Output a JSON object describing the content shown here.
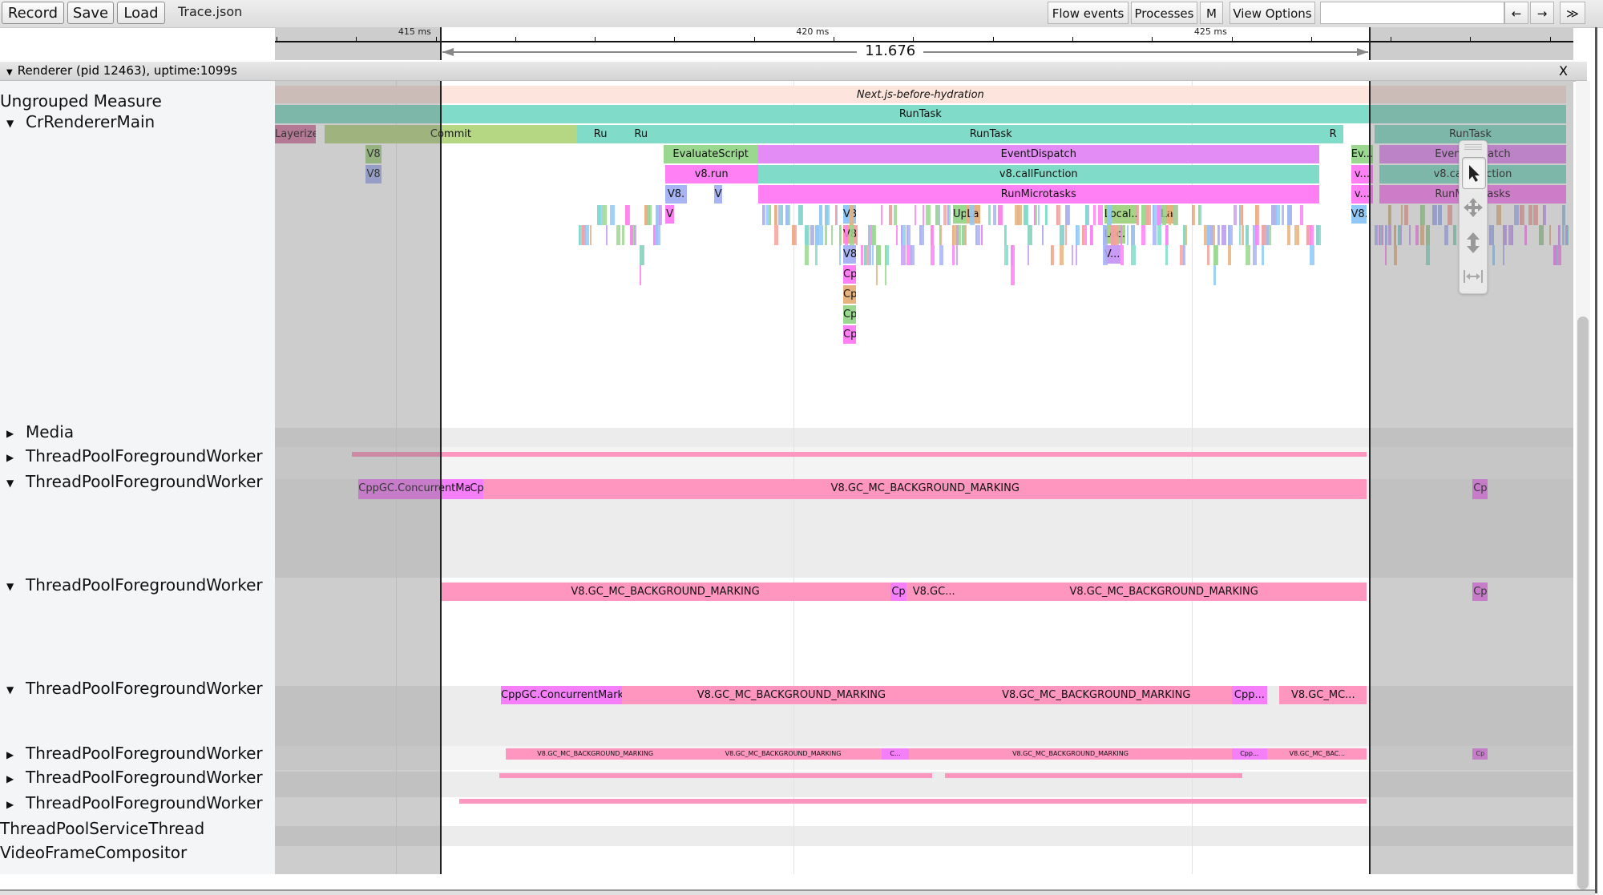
{
  "toolbar": {
    "record_label": "Record",
    "save_label": "Save",
    "load_label": "Load",
    "file_name": "Trace.json",
    "flow_events_label": "Flow events",
    "processes_label": "Processes",
    "m_label": "M",
    "view_options_label": "View Options",
    "search_value": "",
    "prev_label": "←",
    "next_label": "→",
    "expand_label": "≫"
  },
  "ruler": {
    "ticks": [
      {
        "ms": 415,
        "label": "415 ms"
      },
      {
        "ms": 420,
        "label": "420 ms"
      },
      {
        "ms": 425,
        "label": "425 ms"
      }
    ],
    "selection_start_ms": 415.56,
    "selection_end_ms": 427.236,
    "selection_duration_label": "11.676 ms"
  },
  "process": {
    "title": "Renderer (pid 12463), uptime:1099s",
    "close_label": "X"
  },
  "threads": [
    {
      "name": "Ungrouped Measure",
      "arrow": ""
    },
    {
      "name": "CrRendererMain",
      "arrow": "▼"
    },
    {
      "name": "Media",
      "arrow": "▶"
    },
    {
      "name": "ThreadPoolForegroundWorker",
      "arrow": "▶"
    },
    {
      "name": "ThreadPoolForegroundWorker",
      "arrow": "▼"
    },
    {
      "name": "ThreadPoolForegroundWorker",
      "arrow": "▼"
    },
    {
      "name": "ThreadPoolForegroundWorker",
      "arrow": "▼"
    },
    {
      "name": "ThreadPoolForegroundWorker",
      "arrow": "▶"
    },
    {
      "name": "ThreadPoolForegroundWorker",
      "arrow": "▶"
    },
    {
      "name": "ThreadPoolForegroundWorker",
      "arrow": "▶"
    },
    {
      "name": "ThreadPoolServiceThread",
      "arrow": ""
    },
    {
      "name": "VideoFrameCompositor",
      "arrow": ""
    }
  ],
  "colors": {
    "measure": "#fde5dd",
    "runtask": "#80dcc8",
    "commit": "#b5d683",
    "layerize": "#d87aa6",
    "eventdispatch": "#e48cf5",
    "callfunction": "#80dcc8",
    "microtasks": "#ff80f5",
    "gcmarking": "#ff96c0",
    "cppgc": "#f47ff8",
    "v8blue": "#90c8f8",
    "v8red": "#f7a19a",
    "v8violet": "#a8b4f4",
    "green": "#9ad88f",
    "orange": "#e6b27f",
    "purple": "#c89cf4",
    "lightgreen": "#a6d487"
  },
  "slices": [
    {
      "track": "measure",
      "depth": 0,
      "start": 413.48,
      "end": 429.7,
      "name": "Next.js-before-hydration",
      "color": "measure",
      "italic": true
    },
    {
      "track": "main",
      "depth": 0,
      "start": 413.48,
      "end": 429.7,
      "name": "RunTask",
      "color": "runtask"
    },
    {
      "track": "main",
      "depth": 1,
      "start": 413.48,
      "end": 413.99,
      "name": "Layerize",
      "color": "layerize"
    },
    {
      "track": "main",
      "depth": 1,
      "start": 414.1,
      "end": 417.28,
      "name": "Commit",
      "color": "commit"
    },
    {
      "track": "main",
      "depth": 1,
      "start": 417.28,
      "end": 417.86,
      "name": "Ru",
      "color": "runtask"
    },
    {
      "track": "main",
      "depth": 1,
      "start": 417.86,
      "end": 418.3,
      "name": "Ru",
      "color": "runtask"
    },
    {
      "track": "main",
      "depth": 1,
      "start": 418.3,
      "end": 426.65,
      "name": "RunTask",
      "color": "runtask"
    },
    {
      "track": "main",
      "depth": 1,
      "start": 426.65,
      "end": 426.9,
      "name": "R",
      "color": "runtask"
    },
    {
      "track": "main",
      "depth": 1,
      "start": 427.3,
      "end": 429.7,
      "name": "RunTask",
      "color": "runtask"
    },
    {
      "track": "main",
      "depth": 2,
      "start": 414.62,
      "end": 414.82,
      "name": "V8",
      "color": "lightgreen"
    },
    {
      "track": "main",
      "depth": 2,
      "start": 418.36,
      "end": 419.55,
      "name": "EvaluateScript",
      "color": "green"
    },
    {
      "track": "main",
      "depth": 2,
      "start": 419.55,
      "end": 426.6,
      "name": "EventDispatch",
      "color": "eventdispatch"
    },
    {
      "track": "main",
      "depth": 2,
      "start": 427.0,
      "end": 427.28,
      "name": "Ev...",
      "color": "green"
    },
    {
      "track": "main",
      "depth": 2,
      "start": 427.36,
      "end": 429.7,
      "name": "EventDispatch",
      "color": "eventdispatch"
    },
    {
      "track": "main",
      "depth": 3,
      "start": 414.62,
      "end": 414.82,
      "name": "V8",
      "color": "v8violet"
    },
    {
      "track": "main",
      "depth": 3,
      "start": 418.38,
      "end": 419.55,
      "name": "v8.run",
      "color": "microtasks"
    },
    {
      "track": "main",
      "depth": 3,
      "start": 419.55,
      "end": 426.6,
      "name": "v8.callFunction",
      "color": "callfunction"
    },
    {
      "track": "main",
      "depth": 3,
      "start": 427.0,
      "end": 427.28,
      "name": "v...",
      "color": "microtasks"
    },
    {
      "track": "main",
      "depth": 3,
      "start": 427.36,
      "end": 429.7,
      "name": "v8.callFunction",
      "color": "callfunction"
    },
    {
      "track": "main",
      "depth": 4,
      "start": 418.38,
      "end": 418.66,
      "name": "V8.",
      "color": "v8violet"
    },
    {
      "track": "main",
      "depth": 4,
      "start": 419.0,
      "end": 419.1,
      "name": "V",
      "color": "v8violet"
    },
    {
      "track": "main",
      "depth": 4,
      "start": 419.55,
      "end": 426.6,
      "name": "RunMicrotasks",
      "color": "microtasks"
    },
    {
      "track": "main",
      "depth": 4,
      "start": 427.0,
      "end": 427.28,
      "name": "v...",
      "color": "microtasks"
    },
    {
      "track": "main",
      "depth": 4,
      "start": 427.36,
      "end": 429.7,
      "name": "RunMicrotasks",
      "color": "microtasks"
    },
    {
      "track": "main",
      "depth": 5,
      "start": 418.38,
      "end": 418.5,
      "name": "V",
      "color": "microtasks"
    },
    {
      "track": "main",
      "depth": 5,
      "start": 420.62,
      "end": 420.78,
      "name": "V8.",
      "color": "v8blue"
    },
    {
      "track": "main",
      "depth": 5,
      "start": 422.0,
      "end": 422.16,
      "name": "Up",
      "color": "green"
    },
    {
      "track": "main",
      "depth": 5,
      "start": 422.16,
      "end": 422.34,
      "name": "La",
      "color": "orange"
    },
    {
      "track": "main",
      "depth": 5,
      "start": 423.9,
      "end": 424.32,
      "name": "Local...",
      "color": "lightgreen"
    },
    {
      "track": "main",
      "depth": 5,
      "start": 424.6,
      "end": 424.78,
      "name": "La",
      "color": "orange"
    },
    {
      "track": "main",
      "depth": 5,
      "start": 427.0,
      "end": 427.2,
      "name": "V8.",
      "color": "v8blue"
    },
    {
      "track": "main",
      "depth": 6,
      "start": 420.62,
      "end": 420.78,
      "name": "V8.",
      "color": "v8red"
    },
    {
      "track": "main",
      "depth": 6,
      "start": 423.9,
      "end": 424.16,
      "name": "Loc...",
      "color": "lightgreen"
    },
    {
      "track": "main",
      "depth": 7,
      "start": 420.62,
      "end": 420.78,
      "name": "V8.",
      "color": "v8violet"
    },
    {
      "track": "main",
      "depth": 7,
      "start": 423.9,
      "end": 424.1,
      "name": "V...",
      "color": "purple"
    },
    {
      "track": "main",
      "depth": 8,
      "start": 420.62,
      "end": 420.78,
      "name": "Cpp",
      "color": "microtasks"
    },
    {
      "track": "main",
      "depth": 9,
      "start": 420.62,
      "end": 420.78,
      "name": "Cpp",
      "color": "orange"
    },
    {
      "track": "main",
      "depth": 10,
      "start": 420.62,
      "end": 420.78,
      "name": "Cpp",
      "color": "green"
    },
    {
      "track": "main",
      "depth": 11,
      "start": 420.62,
      "end": 420.78,
      "name": "Cpp",
      "color": "microtasks"
    },
    {
      "track": "tp1",
      "depth": 0,
      "start": 414.45,
      "end": 427.2,
      "name": "",
      "color": "gcmarking",
      "thin": true
    },
    {
      "track": "tp2",
      "depth": 0,
      "start": 414.53,
      "end": 415.93,
      "name": "CppGC.ConcurrentMark",
      "color": "cppgc"
    },
    {
      "track": "tp2",
      "depth": 0,
      "start": 415.93,
      "end": 416.1,
      "name": "Cp",
      "color": "cppgc"
    },
    {
      "track": "tp2",
      "depth": 0,
      "start": 416.1,
      "end": 427.2,
      "name": "V8.GC_MC_BACKGROUND_MARKING",
      "color": "gcmarking"
    },
    {
      "track": "tp2",
      "depth": 0,
      "start": 428.53,
      "end": 428.72,
      "name": "Cp",
      "color": "cppgc"
    },
    {
      "track": "tp3",
      "depth": 0,
      "start": 415.56,
      "end": 421.21,
      "name": "V8.GC_MC_BACKGROUND_MARKING",
      "color": "gcmarking"
    },
    {
      "track": "tp3",
      "depth": 0,
      "start": 421.21,
      "end": 421.42,
      "name": "Cp",
      "color": "cppgc"
    },
    {
      "track": "tp3",
      "depth": 0,
      "start": 421.42,
      "end": 422.1,
      "name": "V8.GC...",
      "color": "gcmarking"
    },
    {
      "track": "tp3",
      "depth": 0,
      "start": 422.1,
      "end": 427.2,
      "name": "V8.GC_MC_BACKGROUND_MARKING",
      "color": "gcmarking"
    },
    {
      "track": "tp3",
      "depth": 0,
      "start": 428.53,
      "end": 428.72,
      "name": "Cp",
      "color": "cppgc"
    },
    {
      "track": "tp4",
      "depth": 0,
      "start": 416.32,
      "end": 417.84,
      "name": "CppGC.ConcurrentMark",
      "color": "cppgc"
    },
    {
      "track": "tp4",
      "depth": 0,
      "start": 417.84,
      "end": 422.1,
      "name": "V8.GC_MC_BACKGROUND_MARKING",
      "color": "gcmarking"
    },
    {
      "track": "tp4",
      "depth": 0,
      "start": 422.1,
      "end": 425.5,
      "name": "V8.GC_MC_BACKGROUND_MARKING",
      "color": "gcmarking"
    },
    {
      "track": "tp4",
      "depth": 0,
      "start": 425.5,
      "end": 425.95,
      "name": "Cpp...",
      "color": "cppgc"
    },
    {
      "track": "tp4",
      "depth": 0,
      "start": 426.1,
      "end": 427.2,
      "name": "V8.GC_MC...",
      "color": "gcmarking"
    },
    {
      "track": "tp5",
      "depth": 0,
      "start": 416.38,
      "end": 418.63,
      "name": "V8.GC_MC_BACKGROUND_MARKING",
      "color": "gcmarking",
      "small": true
    },
    {
      "track": "tp5",
      "depth": 0,
      "start": 418.63,
      "end": 421.1,
      "name": "V8.GC_MC_BACKGROUND_MARKING",
      "color": "gcmarking",
      "small": true
    },
    {
      "track": "tp5",
      "depth": 0,
      "start": 421.1,
      "end": 421.45,
      "name": "C...",
      "color": "cppgc",
      "small": true
    },
    {
      "track": "tp5",
      "depth": 0,
      "start": 421.45,
      "end": 425.5,
      "name": "V8.GC_MC_BACKGROUND_MARKING",
      "color": "gcmarking",
      "small": true
    },
    {
      "track": "tp5",
      "depth": 0,
      "start": 425.5,
      "end": 425.95,
      "name": "Cpp...",
      "color": "cppgc",
      "small": true
    },
    {
      "track": "tp5",
      "depth": 0,
      "start": 425.95,
      "end": 427.2,
      "name": "V8.GC_MC_BAC...",
      "color": "gcmarking",
      "small": true
    },
    {
      "track": "tp5",
      "depth": 0,
      "start": 428.53,
      "end": 428.72,
      "name": "Cp",
      "color": "cppgc",
      "small": true
    },
    {
      "track": "tp6",
      "depth": 0,
      "start": 416.3,
      "end": 421.74,
      "name": "",
      "color": "gcmarking",
      "thin": true
    },
    {
      "track": "tp6",
      "depth": 0,
      "start": 421.9,
      "end": 425.64,
      "name": "",
      "color": "gcmarking",
      "thin": true
    },
    {
      "track": "tp7",
      "depth": 0,
      "start": 415.8,
      "end": 427.2,
      "name": "",
      "color": "gcmarking",
      "thin": true
    }
  ]
}
